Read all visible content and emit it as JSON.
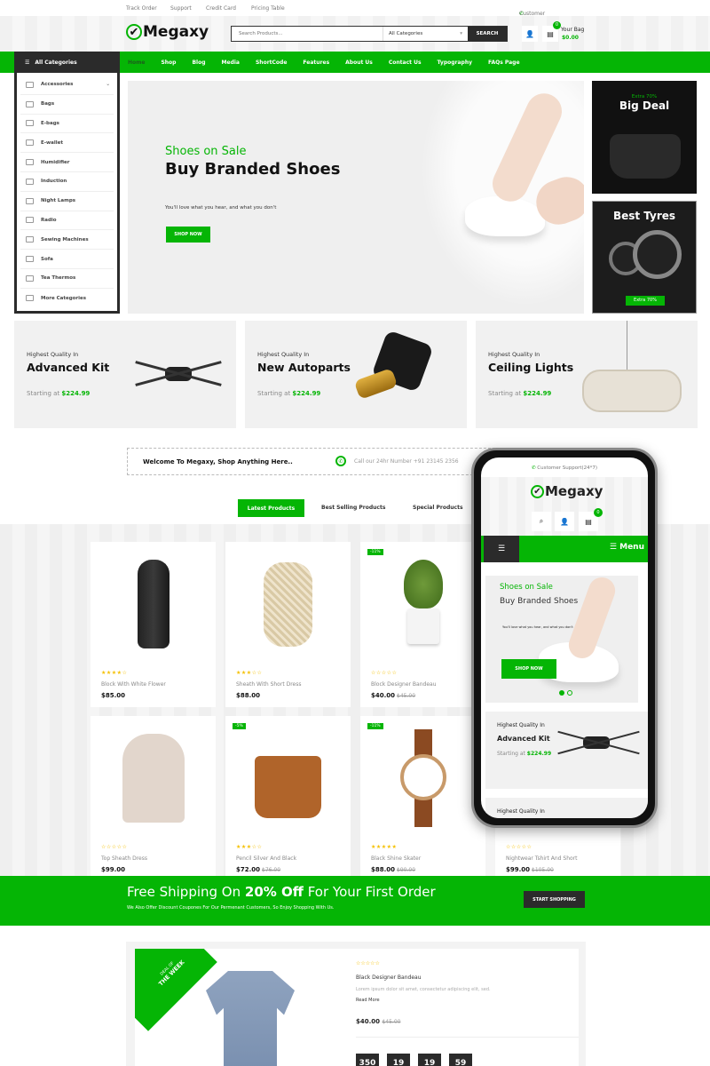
{
  "topbar": {
    "links": [
      "Track Order",
      "Support",
      "Credit Card",
      "Pricing Table"
    ],
    "support": "Customer Support(24*7)"
  },
  "header": {
    "logo": "Megaxy",
    "search_placeholder": "Search Products...",
    "category": "All Categories",
    "search_button": "SEARCH",
    "cart_count": "0",
    "bag_label": "Your Bag",
    "bag_total": "$0.00"
  },
  "nav": {
    "all_categories": "All Categories",
    "items": [
      "Home",
      "Shop",
      "Blog",
      "Media",
      "ShortCode",
      "Features",
      "About Us",
      "Contact Us",
      "Typography",
      "FAQs Page"
    ]
  },
  "sidebar": {
    "items": [
      "Accessories",
      "Bags",
      "E-bags",
      "E-wallet",
      "Humidifier",
      "Induction",
      "Night Lamps",
      "Radio",
      "Sewing Machines",
      "Sofa",
      "Tea Thermos",
      "More Categories"
    ]
  },
  "hero": {
    "kicker": "Shoes on Sale",
    "title": "Buy Branded Shoes",
    "subtitle": "You'll love what you hear, and what you don't",
    "button": "SHOP NOW"
  },
  "side_banners": [
    {
      "kicker": "Extra 70%",
      "title": "Big Deal"
    },
    {
      "title": "Best Tyres",
      "button": "Extra 70%"
    }
  ],
  "category_banners": [
    {
      "kicker": "Highest Quality In",
      "title": "Advanced Kit",
      "starting": "Starting at",
      "price": "$224.99"
    },
    {
      "kicker": "Highest Quality In",
      "title": "New Autoparts",
      "starting": "Starting at",
      "price": "$224.99"
    },
    {
      "kicker": "Highest Quality In",
      "title": "Ceiling Lights",
      "starting": "Starting at",
      "price": "$224.99"
    }
  ],
  "welcome": {
    "text": "Welcome To Megaxy, Shop Anything Here..",
    "call": "Call our 24hr Number +91 23145 2356"
  },
  "tabs": [
    "Latest Products",
    "Best Selling Products",
    "Special Products"
  ],
  "products": [
    {
      "name": "Block With White Flower",
      "price": "$85.00",
      "old": "",
      "stars": 4,
      "badge": ""
    },
    {
      "name": "Sheath With Short Dress",
      "price": "$88.00",
      "old": "",
      "stars": 3,
      "badge": ""
    },
    {
      "name": "Block Designer Bandeau",
      "price": "$40.00",
      "old": "$45.00",
      "stars": 0,
      "badge": "-11%"
    },
    {
      "name": "Top Sheath Dress",
      "price": "$99.00",
      "old": "",
      "stars": 0,
      "badge": ""
    },
    {
      "name": "Pencil Silver And Black",
      "price": "$72.00",
      "old": "$76.00",
      "stars": 3,
      "badge": "-5%"
    },
    {
      "name": "Black Shine Skater",
      "price": "$88.00",
      "old": "$90.00",
      "stars": 5,
      "badge": "-11%"
    },
    {
      "name": "Nightwear Tshirt And Short",
      "price": "$99.00",
      "old": "$105.00",
      "stars": 0,
      "badge": ""
    }
  ],
  "shipping": {
    "pre": "Free Shipping On ",
    "bold": "20% Off",
    "post": " For Your First Order",
    "sub": "We Also Offer Discount Coupones For Our Permenant Customers, So Enjoy Shopping With Us.",
    "button": "START SHOPPING"
  },
  "deal": {
    "ribbon1": "DEAL OF",
    "ribbon2": "THE WEEK",
    "name": "Black Designer Bandeau",
    "desc": "Lorem ipsum dolor sit amet, consectetur adipiscing elit, sed.",
    "read_more": "Read More",
    "price": "$40.00",
    "old": "$45.00",
    "countdown": [
      "350",
      "19",
      "19",
      "59"
    ]
  },
  "phone": {
    "support": "Customer Support(24*7)",
    "logo": "Megaxy",
    "cart_count": "0",
    "menu": "Menu",
    "kicker": "Shoes on Sale",
    "title": "Buy Branded Shoes",
    "subtitle": "You'll love what you hear, and what you don't",
    "button": "SHOP NOW",
    "cat_kicker": "Highest Quality In",
    "cat_title": "Advanced Kit",
    "starting": "Starting at",
    "price": "$224.99",
    "cat2_kicker": "Highest Quality In"
  },
  "colors": {
    "accent": "#05b505",
    "dark": "#2b2b2b",
    "star": "#f5c000"
  }
}
